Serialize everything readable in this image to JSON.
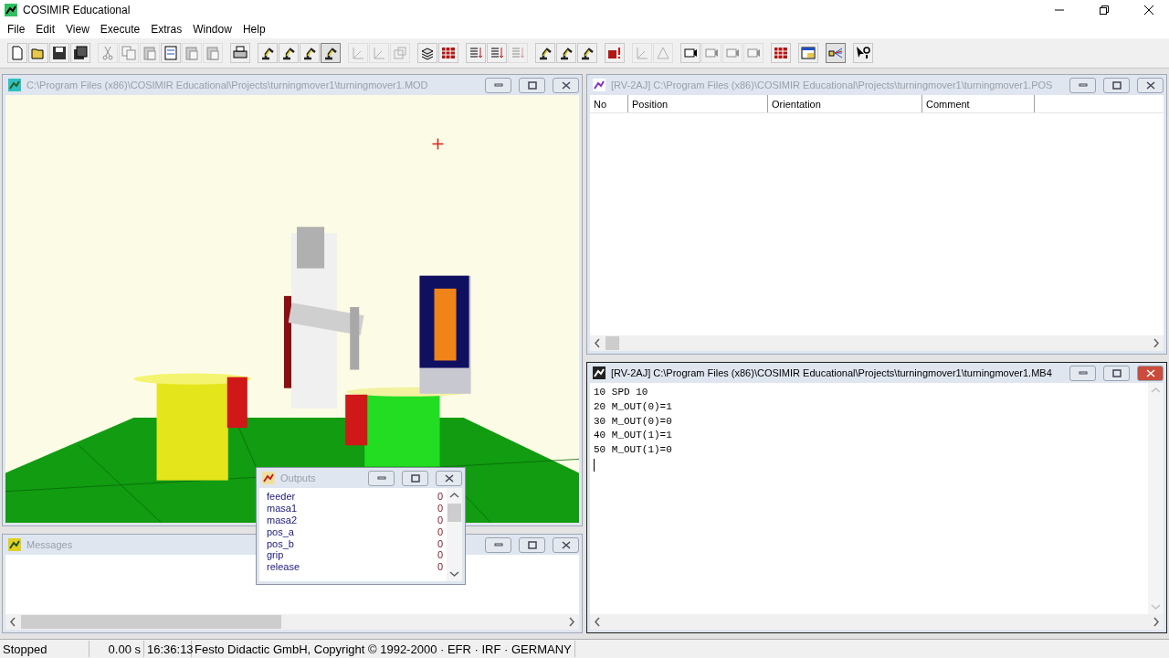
{
  "window": {
    "title": "COSIMIR Educational"
  },
  "menu": [
    "File",
    "Edit",
    "View",
    "Execute",
    "Extras",
    "Window",
    "Help"
  ],
  "toolbar": [
    [
      {
        "kind": "new",
        "disabled": false,
        "pressed": false
      },
      {
        "kind": "open",
        "disabled": false,
        "pressed": false
      },
      {
        "kind": "save",
        "disabled": false,
        "pressed": false
      },
      {
        "kind": "save-all",
        "disabled": false,
        "pressed": false
      }
    ],
    [
      {
        "kind": "cut",
        "disabled": true,
        "pressed": false
      },
      {
        "kind": "copy",
        "disabled": true,
        "pressed": false
      },
      {
        "kind": "paste",
        "disabled": true,
        "pressed": false
      },
      {
        "kind": "numbers",
        "disabled": false,
        "pressed": false
      },
      {
        "kind": "paste",
        "disabled": true,
        "pressed": false
      },
      {
        "kind": "paste",
        "disabled": true,
        "pressed": false
      }
    ],
    [
      {
        "kind": "print",
        "disabled": false,
        "pressed": false
      }
    ],
    [
      {
        "kind": "robot",
        "disabled": false,
        "pressed": false
      },
      {
        "kind": "robot",
        "disabled": false,
        "pressed": false
      },
      {
        "kind": "robot",
        "disabled": false,
        "pressed": false
      },
      {
        "kind": "robot",
        "disabled": false,
        "pressed": true
      }
    ],
    [
      {
        "kind": "axes",
        "disabled": true,
        "pressed": false
      },
      {
        "kind": "axes",
        "disabled": true,
        "pressed": false
      },
      {
        "kind": "frame",
        "disabled": true,
        "pressed": false
      }
    ],
    [
      {
        "kind": "stack",
        "disabled": false,
        "pressed": false
      },
      {
        "kind": "grid",
        "disabled": false,
        "pressed": false
      }
    ],
    [
      {
        "kind": "list",
        "disabled": false,
        "pressed": false
      },
      {
        "kind": "list",
        "disabled": false,
        "pressed": false
      },
      {
        "kind": "list",
        "disabled": true,
        "pressed": false
      }
    ],
    [
      {
        "kind": "robot",
        "disabled": false,
        "pressed": false
      },
      {
        "kind": "robot",
        "disabled": false,
        "pressed": false
      },
      {
        "kind": "robot",
        "disabled": false,
        "pressed": false
      }
    ],
    [
      {
        "kind": "alert",
        "disabled": false,
        "pressed": false
      }
    ],
    [
      {
        "kind": "axes",
        "disabled": true,
        "pressed": false
      },
      {
        "kind": "triangle",
        "disabled": true,
        "pressed": false
      }
    ],
    [
      {
        "kind": "camera",
        "disabled": false,
        "pressed": false
      },
      {
        "kind": "camera",
        "disabled": true,
        "pressed": false
      },
      {
        "kind": "camera",
        "disabled": true,
        "pressed": false
      },
      {
        "kind": "camera",
        "disabled": true,
        "pressed": false
      }
    ],
    [
      {
        "kind": "grid",
        "disabled": false,
        "pressed": false
      }
    ],
    [
      {
        "kind": "window",
        "disabled": false,
        "pressed": false
      }
    ],
    [
      {
        "kind": "signal",
        "disabled": false,
        "pressed": true
      }
    ],
    [
      {
        "kind": "help",
        "disabled": false,
        "pressed": false
      }
    ]
  ],
  "model_window": {
    "title": "C:\\Program Files (x86)\\COSIMIR Educational\\Projects\\turningmover1\\turningmover1.MOD",
    "active": false
  },
  "messages_window": {
    "title": "Messages",
    "active": false
  },
  "positions_window": {
    "title": "[RV-2AJ] C:\\Program Files (x86)\\COSIMIR Educational\\Projects\\turningmover1\\turningmover1.POS",
    "active": false,
    "columns": [
      "No",
      "Position",
      "Orientation",
      "Comment"
    ]
  },
  "program_window": {
    "title": "[RV-2AJ] C:\\Program Files (x86)\\COSIMIR Educational\\Projects\\turningmover1\\turningmover1.MB4",
    "active": true,
    "lines": [
      "10 SPD 10",
      "20 M_OUT(0)=1",
      "30 M_OUT(0)=0",
      "40 M_OUT(1)=1",
      "50 M_OUT(1)=0"
    ]
  },
  "outputs_window": {
    "title": "Outputs",
    "active": false,
    "rows": [
      {
        "name": "feeder",
        "value": "0"
      },
      {
        "name": "masa1",
        "value": "0"
      },
      {
        "name": "masa2",
        "value": "0"
      },
      {
        "name": "pos_a",
        "value": "0"
      },
      {
        "name": "pos_b",
        "value": "0"
      },
      {
        "name": "grip",
        "value": "0"
      },
      {
        "name": "release",
        "value": "0"
      }
    ]
  },
  "status_bar": {
    "state": "Stopped",
    "time": "0.00 s",
    "clock": "16:36:13",
    "copyright": "Festo Didactic GmbH, Copyright © 1992-2000 · EFR · IRF · GERMANY"
  }
}
